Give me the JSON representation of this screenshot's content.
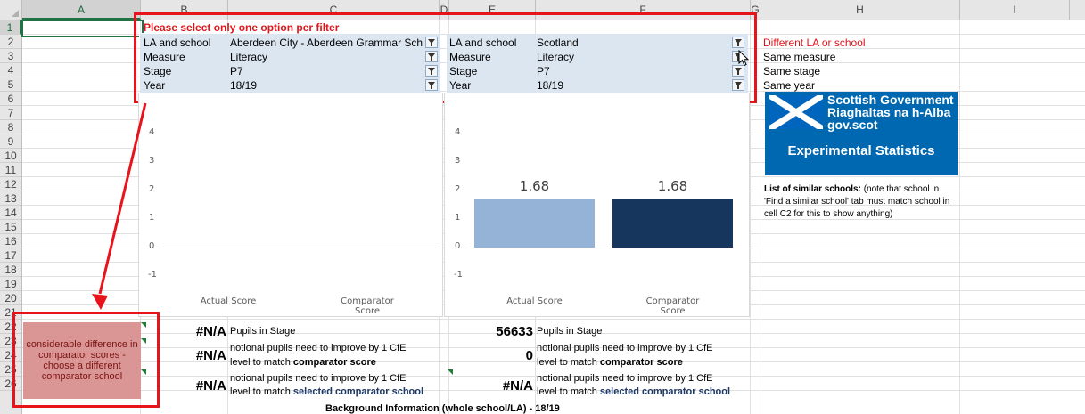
{
  "columns": [
    "A",
    "B",
    "C",
    "D",
    "E",
    "F",
    "G",
    "H",
    "I"
  ],
  "rows": [
    "1",
    "2",
    "3",
    "4",
    "5",
    "6",
    "7",
    "8",
    "9",
    "10",
    "11",
    "12",
    "13",
    "14",
    "15",
    "16",
    "17",
    "18",
    "19",
    "20",
    "21",
    "22",
    "23",
    "24",
    "25",
    "26"
  ],
  "warning": "Please select only one option per filter",
  "filters_left": [
    {
      "label": "LA and school",
      "value": "Aberdeen City - Aberdeen Grammar Sch"
    },
    {
      "label": "Measure",
      "value": "Literacy"
    },
    {
      "label": "Stage",
      "value": "P7"
    },
    {
      "label": "Year",
      "value": "18/19"
    }
  ],
  "filters_right": [
    {
      "label": "LA and school",
      "value": "Scotland"
    },
    {
      "label": "Measure",
      "value": "Literacy"
    },
    {
      "label": "Stage",
      "value": "P7"
    },
    {
      "label": "Year",
      "value": "18/19"
    }
  ],
  "side_notes": {
    "different": "Different LA or school",
    "same_measure": "Same measure",
    "same_stage": "Same stage",
    "same_year": "Same year"
  },
  "logo": {
    "line1": "Scottish Government",
    "line2": "Riaghaltas na h-Alba",
    "line3": "gov.scot",
    "caption": "Experimental Statistics"
  },
  "similar_schools": {
    "heading": "List of similar schools:",
    "note1": " (note that school in",
    "note2": "'Find a similar school' tab must match school in",
    "note3": "cell C2 for this to show anything)"
  },
  "message_box": "considerable difference in comparator scores - choose a different comparator school",
  "stats_left": {
    "pupils_value": "#N/A",
    "pupils_label": "Pupils in Stage",
    "improve_value": "#N/A",
    "improve_line1": "notional pupils need to improve by 1 CfE",
    "improve_line2": "level to match ",
    "improve_bold": "comparator score",
    "selected_value": "#N/A",
    "selected_line1": "notional pupils need to improve by 1 CfE",
    "selected_line2": "level to match ",
    "selected_bold": "selected comparator school"
  },
  "stats_right": {
    "pupils_value": "56633",
    "pupils_label": "Pupils in Stage",
    "improve_value": "0",
    "improve_line1": "notional pupils need to improve by 1 CfE",
    "improve_line2": "level to match ",
    "improve_bold": "comparator score",
    "selected_value": "#N/A",
    "selected_line1": "notional pupils need to improve by 1 CfE",
    "selected_line2": "level to match ",
    "selected_bold": "selected comparator school"
  },
  "background_info": "Background Information (whole school/LA) - 18/19",
  "colors": {
    "accent_red": "#e8141b",
    "bar_light": "#95b3d7",
    "bar_dark": "#17365d",
    "logo_blue": "#0067b1",
    "message_fill": "#da9694"
  },
  "chart_data": [
    {
      "type": "bar",
      "categories": [
        "Actual Score",
        "Comparator Score"
      ],
      "values": [
        null,
        null
      ],
      "yticks": [
        -1,
        0,
        1,
        2,
        3,
        4
      ],
      "ylim": [
        -1,
        4
      ],
      "xlabel": "",
      "ylabel": "",
      "title": ""
    },
    {
      "type": "bar",
      "categories": [
        "Actual Score",
        "Comparator Score"
      ],
      "values": [
        1.68,
        1.68
      ],
      "data_labels": [
        "1.68",
        "1.68"
      ],
      "bar_colors": [
        "#95b3d7",
        "#17365d"
      ],
      "yticks": [
        -1,
        0,
        1,
        2,
        3,
        4
      ],
      "ylim": [
        -1,
        4
      ],
      "xlabel": "",
      "ylabel": "",
      "title": ""
    }
  ]
}
